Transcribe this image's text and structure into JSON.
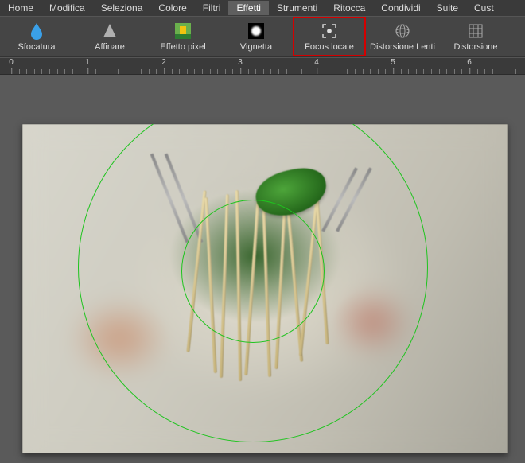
{
  "menu": {
    "items": [
      "Home",
      "Modifica",
      "Seleziona",
      "Colore",
      "Filtri",
      "Effetti",
      "Strumenti",
      "Ritocca",
      "Condividi",
      "Suite",
      "Cust"
    ],
    "active_index": 5
  },
  "toolbar": {
    "tools": [
      {
        "label": "Sfocatura",
        "icon": "blur-icon"
      },
      {
        "label": "Affinare",
        "icon": "sharpen-icon"
      },
      {
        "label": "Effetto pixel",
        "icon": "pixelate-icon"
      },
      {
        "label": "Vignetta",
        "icon": "vignette-icon"
      },
      {
        "label": "Focus locale",
        "icon": "focus-icon"
      },
      {
        "label": "Distorsione Lenti",
        "icon": "lens-distort-icon"
      },
      {
        "label": "Distorsione",
        "icon": "distort-icon"
      }
    ],
    "highlighted_index": 4
  },
  "ruler": {
    "labels": [
      "0",
      "1",
      "2",
      "3",
      "4",
      "5",
      "6"
    ]
  },
  "focus_overlay": {
    "inner_radius_px": 90,
    "outer_radius_px": 220
  }
}
